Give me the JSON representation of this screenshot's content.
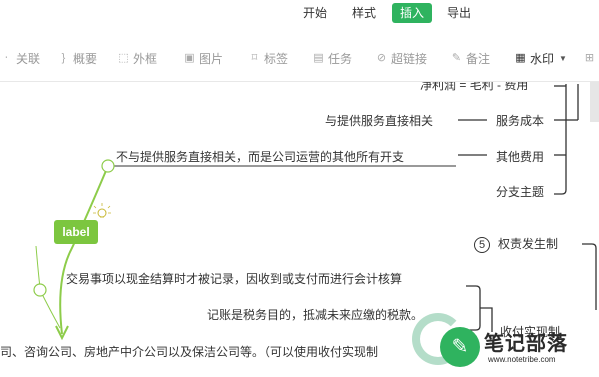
{
  "menu": {
    "tabs": [
      {
        "label": "开始"
      },
      {
        "label": "样式"
      },
      {
        "label": "插入",
        "active": true
      },
      {
        "label": "导出"
      }
    ]
  },
  "toolbar": {
    "items": [
      {
        "label": "关联",
        "icon": "relation-icon"
      },
      {
        "label": "概要",
        "icon": "summary-brace-icon"
      },
      {
        "label": "外框",
        "icon": "boundary-frame-icon"
      },
      {
        "label": "图片",
        "icon": "image-icon"
      },
      {
        "label": "标签",
        "icon": "tag-icon"
      },
      {
        "label": "任务",
        "icon": "task-icon"
      },
      {
        "label": "超链接",
        "icon": "link-icon"
      },
      {
        "label": "备注",
        "icon": "note-icon"
      },
      {
        "label": "水印",
        "icon": "watermark-icon"
      }
    ]
  },
  "mindmap": {
    "top_partial": "净利润 = 毛利 - 费用",
    "service_detail": "与提供服务直接相关",
    "service_cost": "服务成本",
    "other_detail": "不与提供服务直接相关，而是公司运营的其他所有开支",
    "other_cost": "其他费用",
    "branch_topic": "分支主题",
    "label_tag": "label",
    "accrual_number": "5",
    "accrual": "权责发生制",
    "cash_detail_1": "交易事项以现金结算时才被记录，因收到或支付而进行会计核算",
    "cash_detail_2": "记账是税务目的，抵减未来应缴的税款。",
    "cash_basis": "收付实现制",
    "bottom_text": "司、咨询公司、房地产中介公司以及保洁公司等。（可以使用收付实现制"
  },
  "watermark": {
    "title": "笔记部落",
    "url": "www.notetribe.com"
  },
  "colors": {
    "accent": "#2fb35f",
    "label_green": "#7cc63f",
    "line_green": "#8dcc4a"
  }
}
